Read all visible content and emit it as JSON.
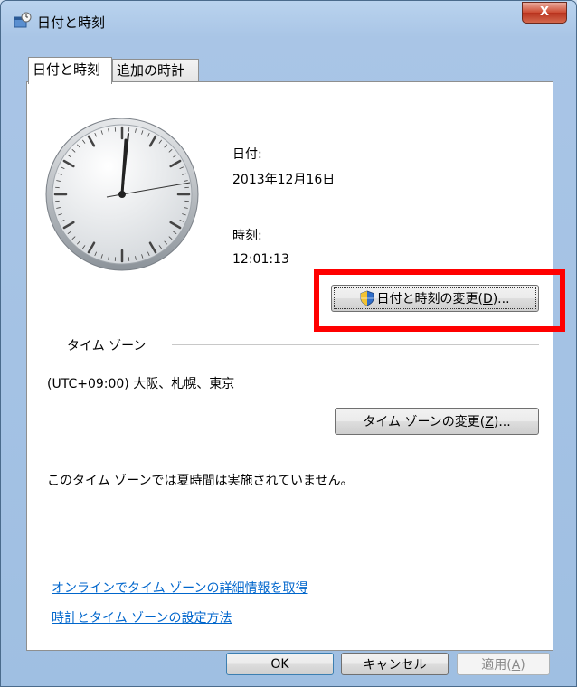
{
  "window": {
    "title": "日付と時刻",
    "close_glyph": "X"
  },
  "tabs": [
    {
      "label": "日付と時刻",
      "active": true
    },
    {
      "label": "追加の時計",
      "active": false
    }
  ],
  "date": {
    "label": "日付:",
    "value": "2013年12月16日"
  },
  "time": {
    "label": "時刻:",
    "value": "12:01:13"
  },
  "change_datetime_button": {
    "label_pre": "日付と時刻の変更(",
    "accel": "D",
    "label_post": ")...",
    "icon": "uac-shield-icon"
  },
  "timezone": {
    "section_label": "タイム ゾーン",
    "value": "(UTC+09:00) 大阪、札幌、東京",
    "change_button": {
      "label_pre": "タイム ゾーンの変更(",
      "accel": "Z",
      "label_post": ")..."
    },
    "dst_note": "このタイム ゾーンでは夏時間は実施されていません。"
  },
  "links": [
    "オンラインでタイム ゾーンの詳細情報を取得",
    "時計とタイム ゾーンの設定方法"
  ],
  "footer": {
    "ok": "OK",
    "cancel": "キャンセル",
    "apply": {
      "label_pre": "適用(",
      "accel": "A",
      "label_post": ")",
      "disabled": true
    }
  },
  "highlight_color": "#ff0000"
}
